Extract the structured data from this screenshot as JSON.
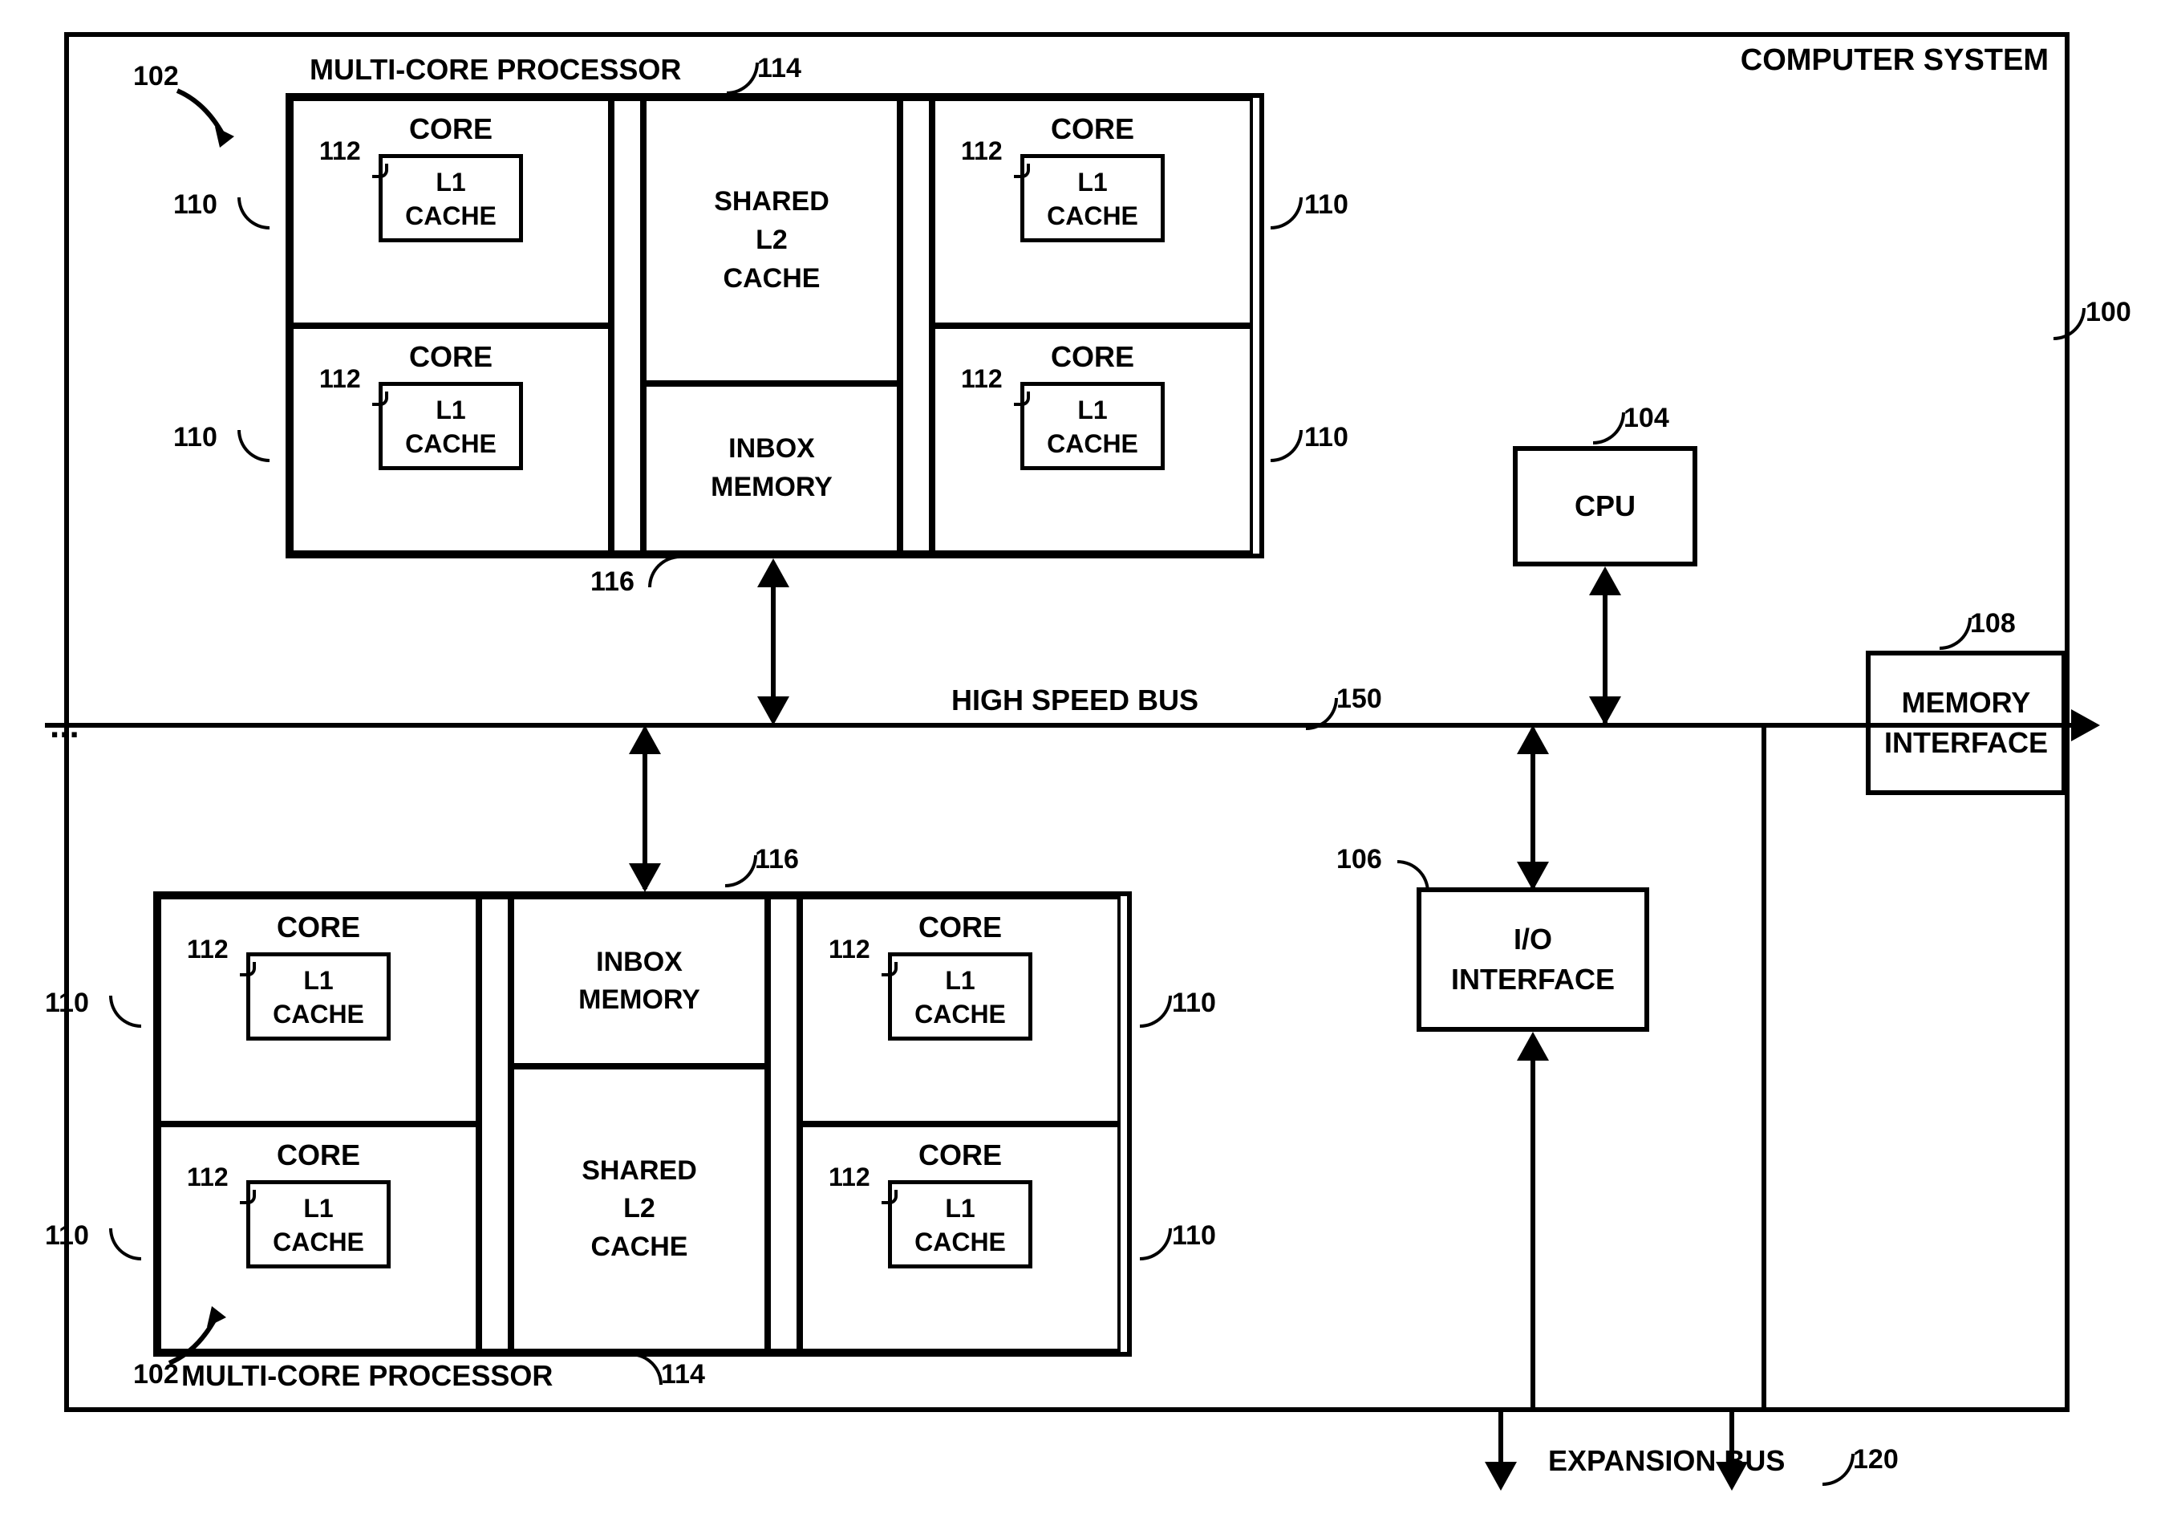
{
  "system_label": "COMPUTER SYSTEM",
  "proc_label": "MULTI-CORE PROCESSOR",
  "core_label": "CORE",
  "l1_label": "L1\nCACHE",
  "l2_label": "SHARED\nL2\nCACHE",
  "inbox_label": "INBOX\nMEMORY",
  "cpu_label": "CPU",
  "io_label": "I/O\nINTERFACE",
  "mem_label": "MEMORY\nINTERFACE",
  "bus_label": "HIGH SPEED BUS",
  "exp_label": "EXPANSION BUS",
  "ref": {
    "n100": "100",
    "n102": "102",
    "n104": "104",
    "n106": "106",
    "n108": "108",
    "n110": "110",
    "n112": "112",
    "n114": "114",
    "n116": "116",
    "n120": "120",
    "n150": "150"
  }
}
